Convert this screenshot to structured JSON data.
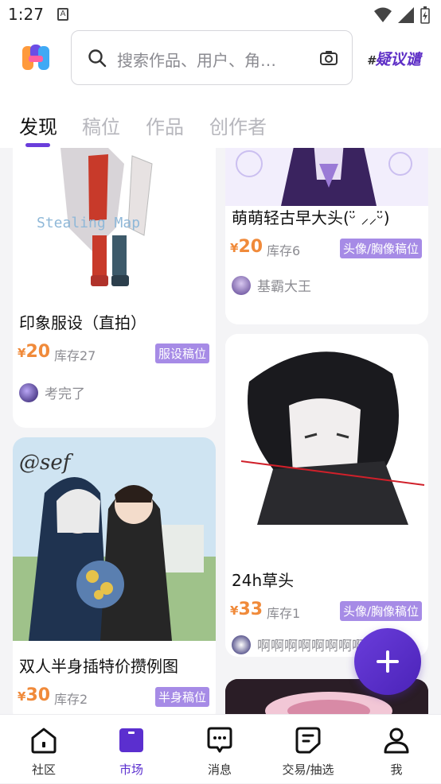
{
  "status_bar": {
    "time": "1:27",
    "sim_label": "A"
  },
  "header": {
    "search_placeholder": "搜索作品、用户、角…",
    "topic_label": "疑议谴",
    "topic_hash": "#"
  },
  "tabs": [
    {
      "label": "发现",
      "active": true
    },
    {
      "label": "稿位",
      "active": false
    },
    {
      "label": "作品",
      "active": false
    },
    {
      "label": "创作者",
      "active": false
    }
  ],
  "cards": [
    {
      "title": "印象服设（直拍）",
      "currency": "¥",
      "price": "20",
      "stock": "库存27",
      "tag": "服设稿位",
      "user": "考完了",
      "image_text": "Stealing Map"
    },
    {
      "title": "萌萌轻古早大头(ᵕ̈ ⸝⸝ᵕ̈)",
      "currency": "¥",
      "price": "20",
      "stock": "库存6",
      "tag": "头像/胸像稿位",
      "user": "基霸大王"
    },
    {
      "title": "双人半身插特价攒例图",
      "currency": "¥",
      "price": "30",
      "stock": "库存2",
      "tag": "半身稿位",
      "image_text": "@sef"
    },
    {
      "title": "24h草头",
      "currency": "¥",
      "price": "33",
      "stock": "库存1",
      "tag": "头像/胸像稿位",
      "user": "啊啊啊啊啊啊啊啊"
    }
  ],
  "nav": [
    {
      "label": "社区",
      "icon": "community-icon",
      "active": false
    },
    {
      "label": "市场",
      "icon": "market-icon",
      "active": true
    },
    {
      "label": "消息",
      "icon": "message-icon",
      "active": false
    },
    {
      "label": "交易/抽选",
      "icon": "trade-icon",
      "active": false
    },
    {
      "label": "我",
      "icon": "profile-icon",
      "active": false
    }
  ],
  "colors": {
    "accent": "#5b2fcf",
    "price": "#f08a3a",
    "tag_bg": "#a68be6"
  }
}
